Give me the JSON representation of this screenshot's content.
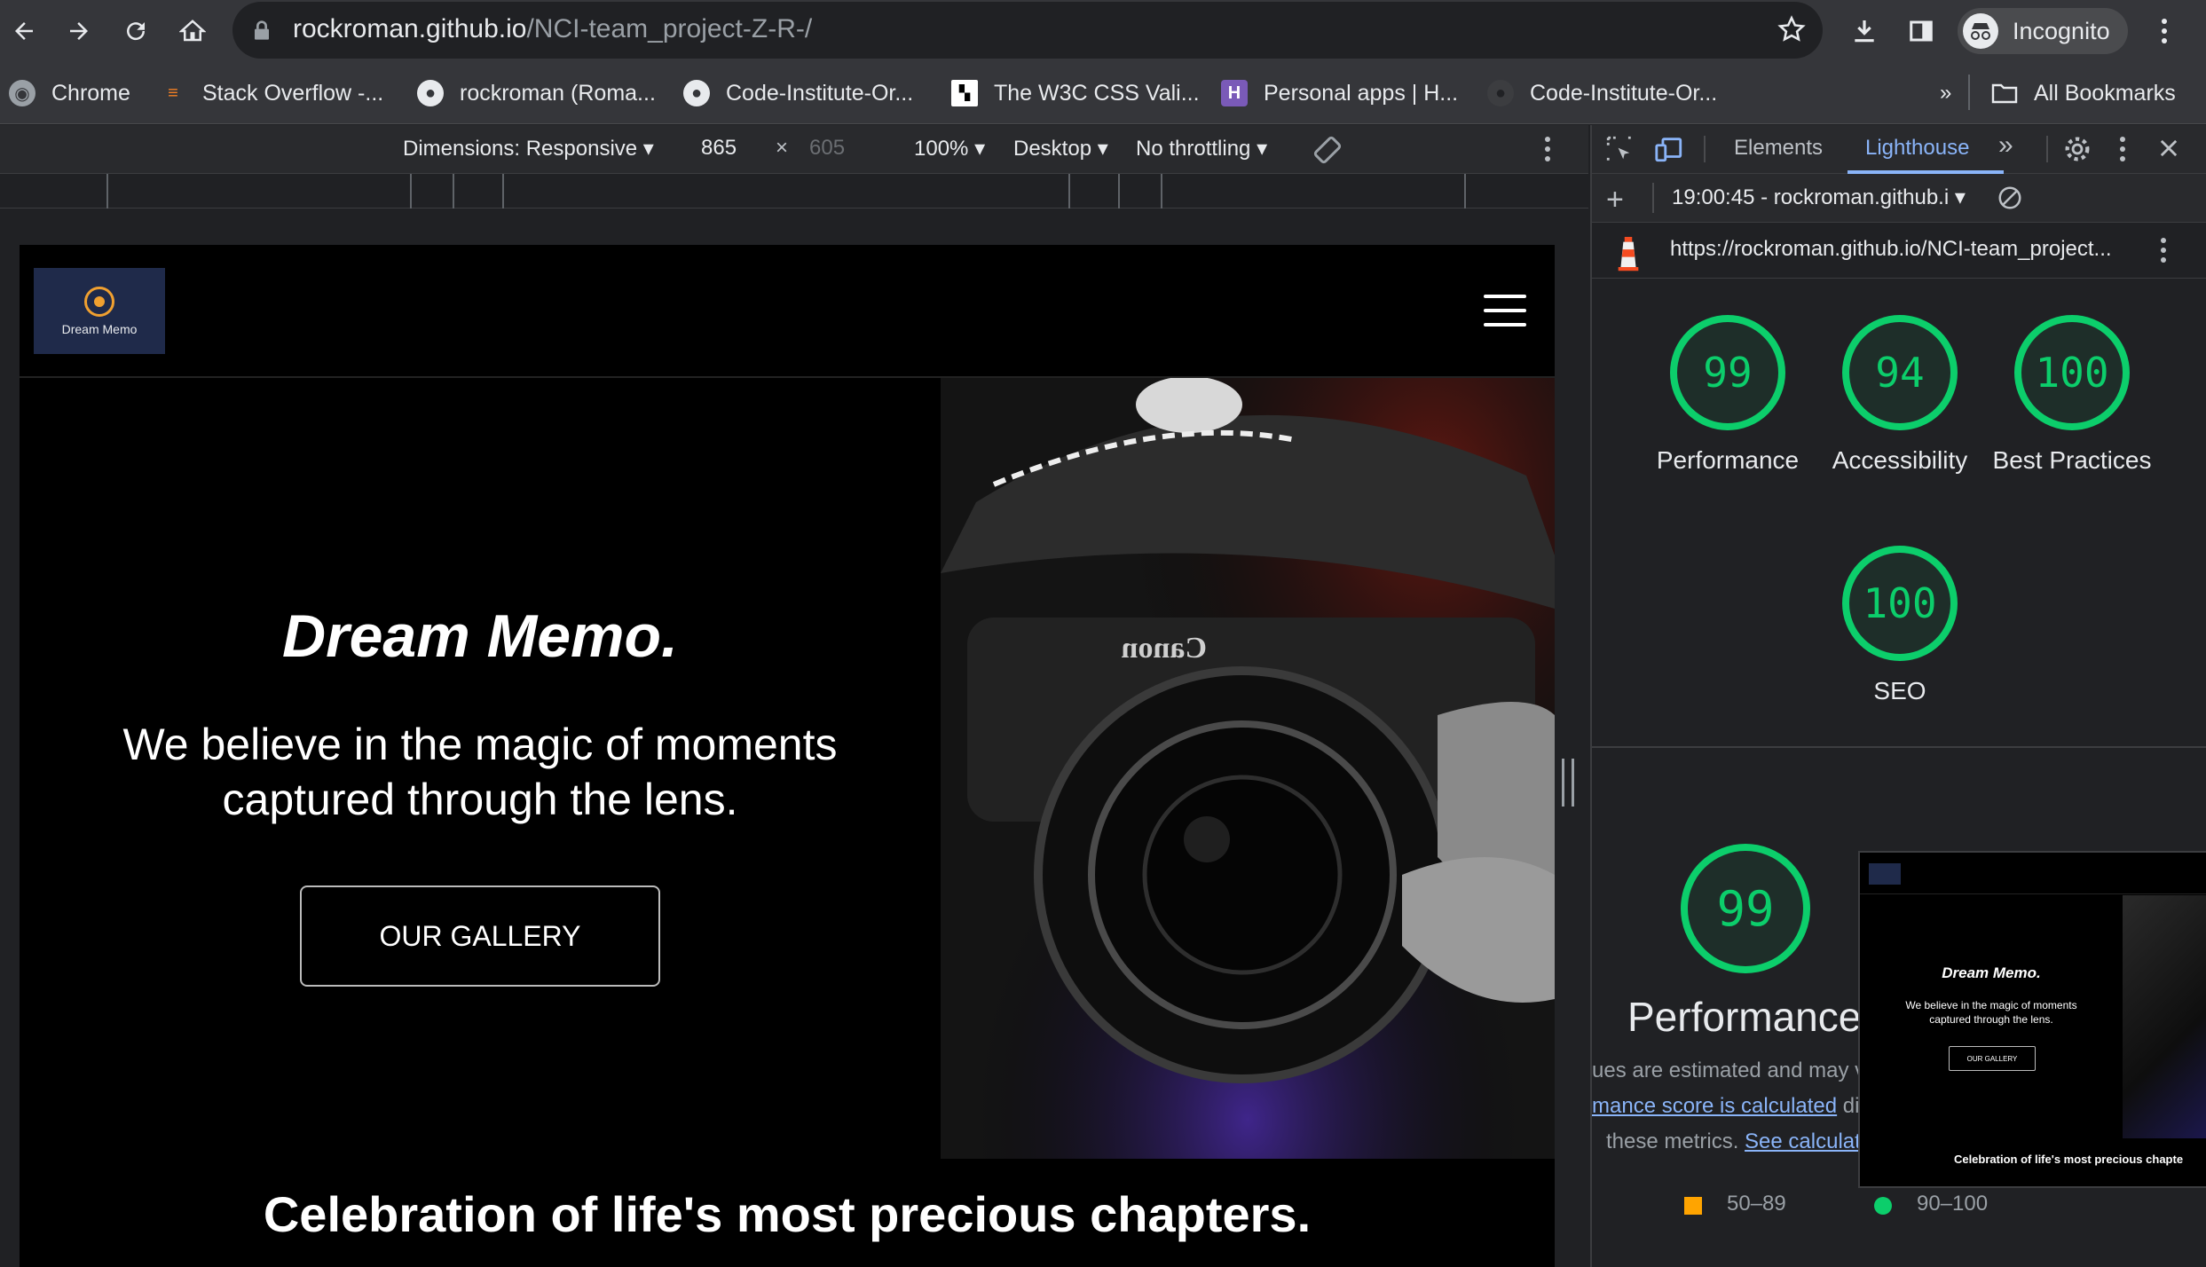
{
  "browser": {
    "url_host": "rockroman.github.io",
    "url_path": "/NCI-team_project-Z-R-/",
    "profile_label": "Incognito",
    "bookmarks": [
      {
        "label": "Chrome",
        "icon": "chrome-icon"
      },
      {
        "label": "Stack Overflow -...",
        "icon": "stackoverflow-icon"
      },
      {
        "label": "rockroman (Roma...",
        "icon": "github-icon"
      },
      {
        "label": "Code-Institute-Or...",
        "icon": "github-icon"
      },
      {
        "label": "The W3C CSS Vali...",
        "icon": "w3c-icon"
      },
      {
        "label": "Personal apps | H...",
        "icon": "heroku-icon"
      },
      {
        "label": "Code-Institute-Or...",
        "icon": "github-icon"
      }
    ],
    "overflow_label": "»",
    "all_bookmarks": "All Bookmarks"
  },
  "device_toolbar": {
    "dimensions": "Dimensions: Responsive",
    "width": "865",
    "height": "605",
    "times": "×",
    "zoom": "100%",
    "device_type": "Desktop",
    "throttling": "No throttling"
  },
  "site": {
    "logo_text": "Dream Memo",
    "hero_title": "Dream Memo.",
    "hero_subtitle": "We believe in the magic of moments captured through the lens.",
    "cta": "OUR GALLERY",
    "section_title": "Celebration of life's most precious chapters.",
    "camera_brand": "Canon"
  },
  "devtools": {
    "tabs": [
      "Elements",
      "Lighthouse"
    ],
    "active_tab": "Lighthouse",
    "report_time": "19:00:45 - rockroman.github.i",
    "report_url": "https://rockroman.github.io/NCI-team_project...",
    "scores": [
      {
        "label": "Performance",
        "value": "99"
      },
      {
        "label": "Accessibility",
        "value": "94"
      },
      {
        "label": "Best Practices",
        "value": "100"
      },
      {
        "label": "SEO",
        "value": "100"
      }
    ],
    "perf_value": "99",
    "perf_title": "Performance",
    "note_1": "ues are estimated and may va",
    "note_2_link": "mance score is calculated",
    "note_2_rest": " di",
    "note_3": "these metrics. ",
    "note_3_link": "See calculat",
    "legend_mid": "50–89",
    "legend_high": "90–100",
    "thumb_title": "Dream Memo.",
    "thumb_sub": "We believe in the magic of moments captured through the lens.",
    "thumb_cta": "OUR GALLERY",
    "thumb_section": "Celebration of life's most precious chapte"
  },
  "colors": {
    "score_green": "#0cce6b",
    "score_orange": "#ffa400",
    "accent_blue": "#8ab4f8"
  }
}
